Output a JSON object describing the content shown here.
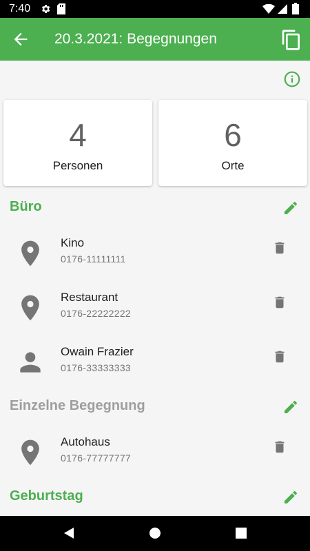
{
  "status_bar": {
    "time": "7:40"
  },
  "app_bar": {
    "title": "20.3.2021: Begegnungen"
  },
  "summary": {
    "persons": {
      "count": "4",
      "label": "Personen"
    },
    "places": {
      "count": "6",
      "label": "Orte"
    }
  },
  "groups": [
    {
      "name": "Büro",
      "color": "#4caf50",
      "entries": [
        {
          "type": "place",
          "icon": "location-pin-icon",
          "name": "Kino",
          "phone": "0176-11111111"
        },
        {
          "type": "place",
          "icon": "location-pin-icon",
          "name": "Restaurant",
          "phone": "0176-22222222"
        },
        {
          "type": "person",
          "icon": "person-icon",
          "name": "Owain Frazier",
          "phone": "0176-33333333"
        }
      ]
    },
    {
      "name": "Einzelne Begegnung",
      "color": "#9e9e9e",
      "entries": [
        {
          "type": "place",
          "icon": "location-pin-icon",
          "name": "Autohaus",
          "phone": "0176-77777777"
        }
      ]
    },
    {
      "name": "Geburtstag",
      "color": "#4caf50",
      "entries": []
    }
  ],
  "colors": {
    "accent": "#4caf50",
    "icon_grey": "#757575",
    "muted_header": "#9e9e9e"
  }
}
